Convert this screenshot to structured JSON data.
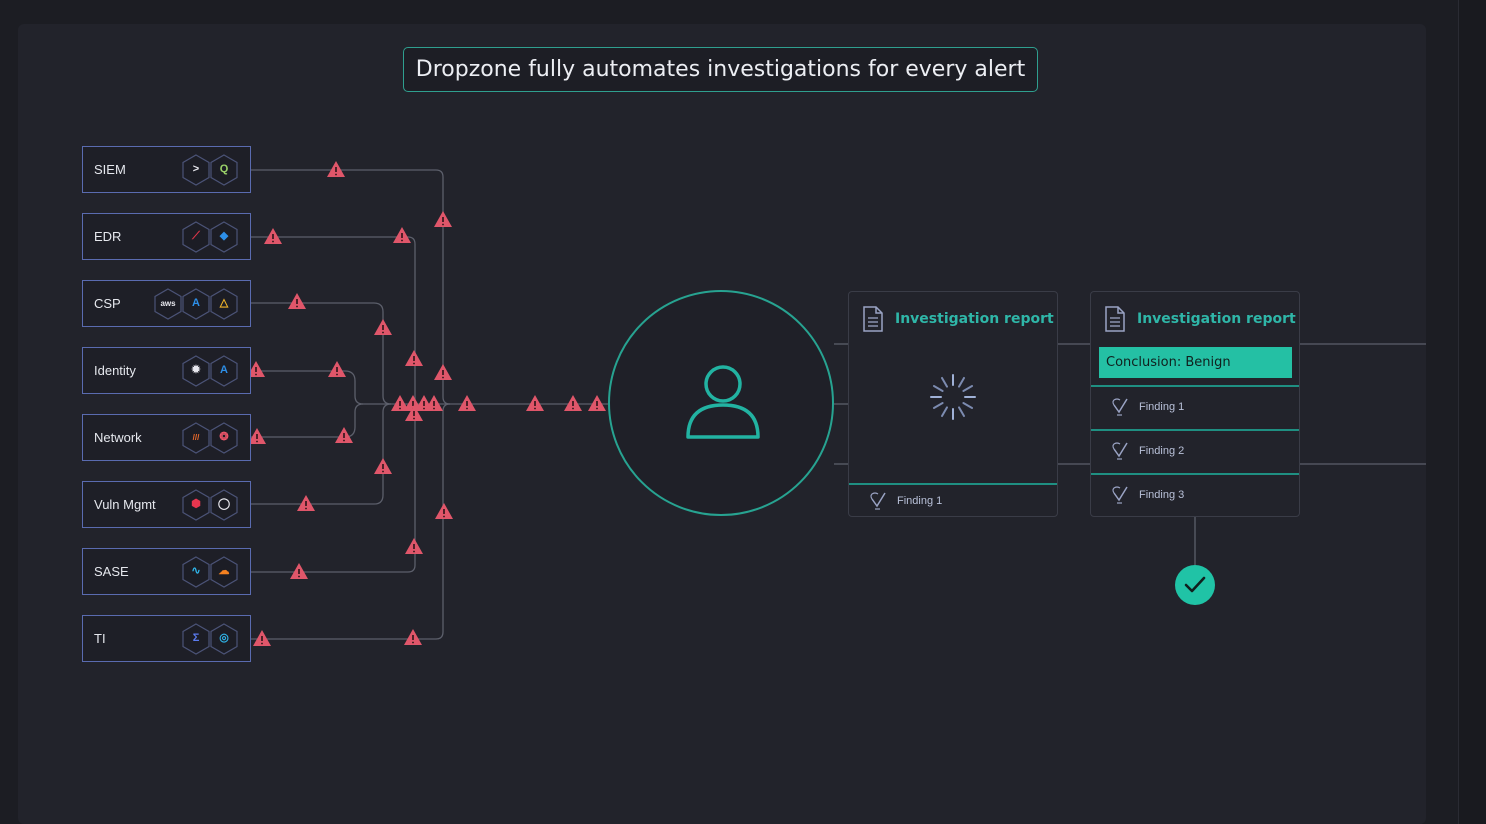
{
  "headline": "Dropzone fully automates investigations for every alert",
  "sources": [
    {
      "label": "SIEM",
      "logos": [
        "terminal-icon",
        "qradar-icon"
      ]
    },
    {
      "label": "EDR",
      "logos": [
        "crowdstrike-icon",
        "defender-shield-icon"
      ]
    },
    {
      "label": "CSP",
      "logos": [
        "aws-icon",
        "azure-icon",
        "gcp-icon"
      ]
    },
    {
      "label": "Identity",
      "logos": [
        "okta-icon",
        "azure-ad-icon"
      ]
    },
    {
      "label": "Network",
      "logos": [
        "palo-alto-icon",
        "meraki-icon"
      ]
    },
    {
      "label": "Vuln Mgmt",
      "logos": [
        "tenable-icon",
        "qualys-icon"
      ]
    },
    {
      "label": "SASE",
      "logos": [
        "zscaler-icon",
        "cloudflare-icon"
      ]
    },
    {
      "label": "TI",
      "logos": [
        "sigma-icon",
        "threat-intel-icon"
      ]
    }
  ],
  "agent": {
    "icon": "user-icon"
  },
  "report_pending": {
    "title": "Investigation report",
    "status_icon": "loading-spinner-icon",
    "findings": [
      "Finding 1"
    ]
  },
  "report_done": {
    "title": "Investigation report",
    "conclusion": "Conclusion: Benign",
    "findings": [
      "Finding 1",
      "Finding 2",
      "Finding 3"
    ]
  },
  "done_icon": "checkmark-icon",
  "colors": {
    "accent": "#24c0a4",
    "alert": "#e0566a",
    "source_border": "#5a6bb0",
    "wire": "#5c5f6b"
  }
}
